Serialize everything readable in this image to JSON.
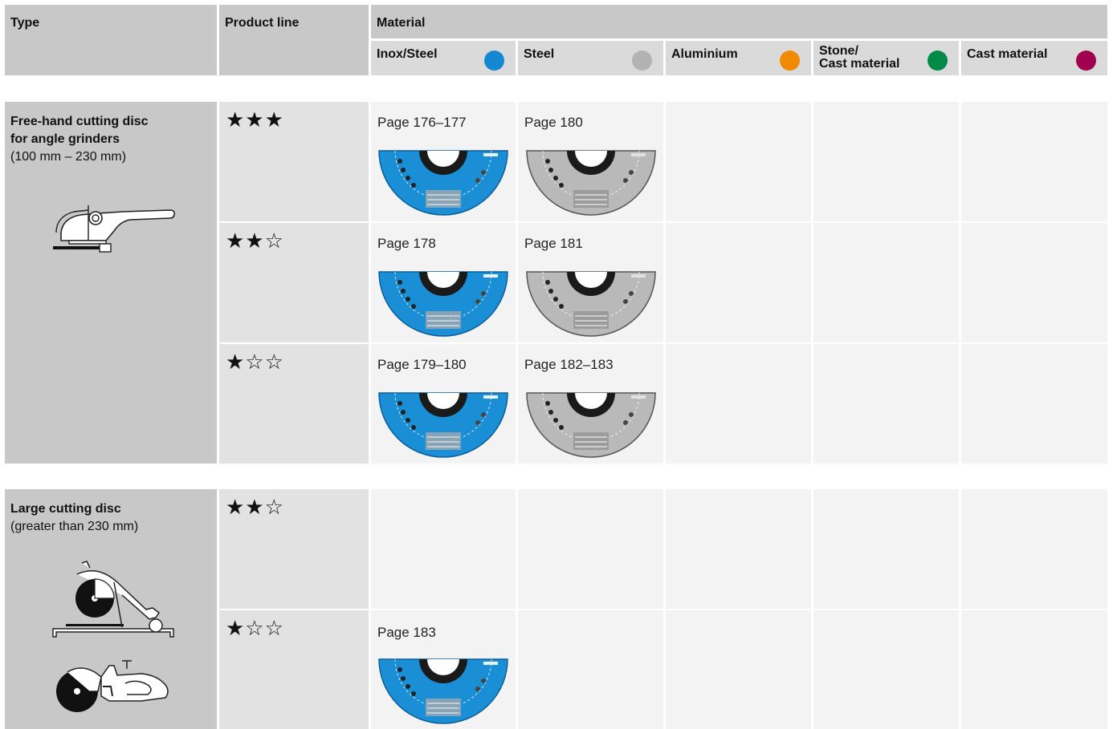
{
  "header": {
    "type": "Type",
    "product_line": "Product line",
    "material": "Material",
    "materials": [
      {
        "label": "Inox/Steel",
        "color": "#1487d1"
      },
      {
        "label": "Steel",
        "color": "#b2b2b2"
      },
      {
        "label": "Aluminium",
        "color": "#f08a00"
      },
      {
        "label": "Stone/\nCast material",
        "color": "#008a45"
      },
      {
        "label": "Cast material",
        "color": "#a0004f"
      }
    ]
  },
  "groups": [
    {
      "name": "Free-hand cutting disc for angle grinders",
      "name_line1": "Free-hand cutting disc",
      "name_line2": "for angle grinders",
      "sub": "(100 mm – 230 mm)",
      "icon": "angle-grinder-icon",
      "rows": [
        {
          "stars": "★★★",
          "rating": 3,
          "inox": "Page 176–177",
          "steel": "Page 180"
        },
        {
          "stars": "★★☆",
          "rating": 2,
          "inox": "Page 178",
          "steel": "Page 181"
        },
        {
          "stars": "★☆☆",
          "rating": 1,
          "inox": "Page 179–180",
          "steel": "Page 182–183"
        }
      ]
    },
    {
      "name": "Large cutting disc",
      "sub": "(greater than 230 mm)",
      "icons": [
        "chop-saw-icon",
        "cut-off-saw-icon"
      ],
      "rows": [
        {
          "stars": "★★☆",
          "rating": 2,
          "inox": "",
          "steel": ""
        },
        {
          "stars": "★☆☆",
          "rating": 1,
          "inox": "Page 183",
          "steel": ""
        }
      ]
    }
  ]
}
